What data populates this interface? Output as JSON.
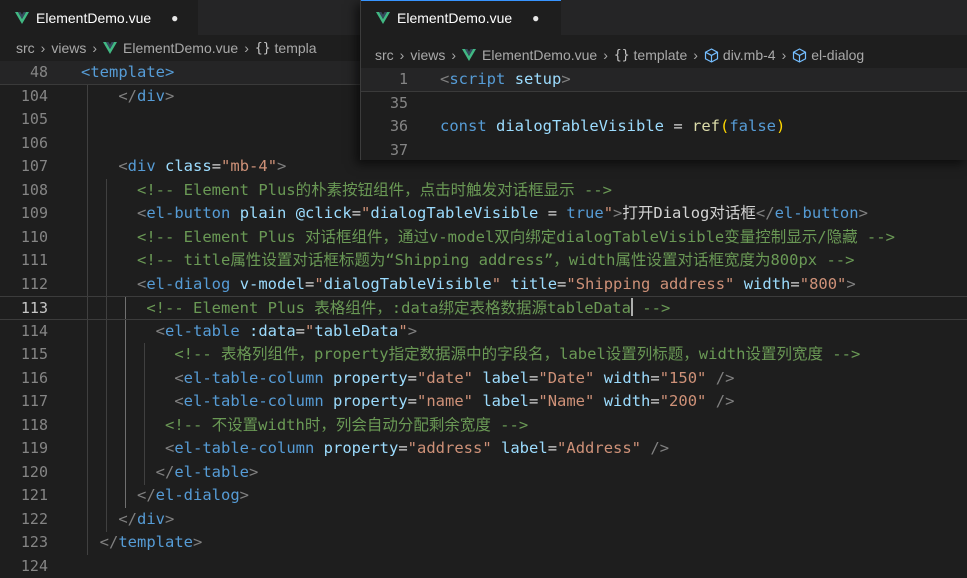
{
  "left_editor": {
    "tab": {
      "title": "ElementDemo.vue",
      "icon": "vue-icon",
      "dirty": "●"
    },
    "breadcrumb": [
      "src",
      "views",
      "ElementDemo.vue",
      "templa"
    ],
    "lines": [
      {
        "num": "48",
        "tokens": [
          [
            "tag",
            "<template>"
          ]
        ]
      },
      {
        "num": "104",
        "tokens": [
          [
            "t",
            "    "
          ],
          [
            "punc",
            "</"
          ],
          [
            "tag",
            "div"
          ],
          [
            "punc",
            ">"
          ]
        ]
      },
      {
        "num": "105",
        "tokens": []
      },
      {
        "num": "106",
        "tokens": []
      },
      {
        "num": "107",
        "tokens": [
          [
            "t",
            "    "
          ],
          [
            "punc",
            "<"
          ],
          [
            "tag",
            "div"
          ],
          [
            "t",
            " "
          ],
          [
            "attr",
            "class"
          ],
          [
            "t",
            "="
          ],
          [
            "str",
            "\"mb-4\""
          ],
          [
            "punc",
            ">"
          ]
        ]
      },
      {
        "num": "108",
        "tokens": [
          [
            "t",
            "      "
          ],
          [
            "com",
            "<!-- Element Plus的朴素按钮组件，点击时触发对话框显示 -->"
          ]
        ]
      },
      {
        "num": "109",
        "tokens": [
          [
            "t",
            "      "
          ],
          [
            "punc",
            "<"
          ],
          [
            "tag",
            "el-button"
          ],
          [
            "t",
            " "
          ],
          [
            "attr",
            "plain"
          ],
          [
            "t",
            " "
          ],
          [
            "attr",
            "@click"
          ],
          [
            "t",
            "="
          ],
          [
            "str",
            "\""
          ],
          [
            "attr",
            "dialogTableVisible"
          ],
          [
            "t",
            " = "
          ],
          [
            "kw",
            "true"
          ],
          [
            "str",
            "\""
          ],
          [
            "punc",
            ">"
          ],
          [
            "t",
            "打开Dialog对话框"
          ],
          [
            "punc",
            "</"
          ],
          [
            "tag",
            "el-button"
          ],
          [
            "punc",
            ">"
          ]
        ]
      },
      {
        "num": "110",
        "tokens": [
          [
            "t",
            "      "
          ],
          [
            "com",
            "<!-- Element Plus 对话框组件，通过v-model双向绑定dialogTableVisible变量控制显示/隐藏 -->"
          ]
        ]
      },
      {
        "num": "111",
        "tokens": [
          [
            "t",
            "      "
          ],
          [
            "com",
            "<!-- title属性设置对话框标题为“Shipping address”，width属性设置对话框宽度为800px -->"
          ]
        ]
      },
      {
        "num": "112",
        "tokens": [
          [
            "t",
            "      "
          ],
          [
            "punc",
            "<"
          ],
          [
            "tag",
            "el-dialog"
          ],
          [
            "t",
            " "
          ],
          [
            "attr",
            "v-model"
          ],
          [
            "t",
            "="
          ],
          [
            "str",
            "\""
          ],
          [
            "attr",
            "dialogTableVisible"
          ],
          [
            "str",
            "\""
          ],
          [
            "t",
            " "
          ],
          [
            "attr",
            "title"
          ],
          [
            "t",
            "="
          ],
          [
            "str",
            "\"Shipping address\""
          ],
          [
            "t",
            " "
          ],
          [
            "attr",
            "width"
          ],
          [
            "t",
            "="
          ],
          [
            "str",
            "\"800\""
          ],
          [
            "punc",
            ">"
          ]
        ]
      },
      {
        "num": "113",
        "tokens": [
          [
            "t",
            "       "
          ],
          [
            "com",
            "<!-- Element Plus 表格组件，:data绑定表格数据源tableData"
          ],
          [
            "caret",
            ""
          ],
          [
            "com",
            " -->"
          ]
        ]
      },
      {
        "num": "114",
        "tokens": [
          [
            "t",
            "        "
          ],
          [
            "punc",
            "<"
          ],
          [
            "tag",
            "el-table"
          ],
          [
            "t",
            " "
          ],
          [
            "attr",
            ":data"
          ],
          [
            "t",
            "="
          ],
          [
            "str",
            "\""
          ],
          [
            "attr",
            "tableData"
          ],
          [
            "str",
            "\""
          ],
          [
            "punc",
            ">"
          ]
        ]
      },
      {
        "num": "115",
        "tokens": [
          [
            "t",
            "          "
          ],
          [
            "com",
            "<!-- 表格列组件，property指定数据源中的字段名，label设置列标题，width设置列宽度 -->"
          ]
        ]
      },
      {
        "num": "116",
        "tokens": [
          [
            "t",
            "          "
          ],
          [
            "punc",
            "<"
          ],
          [
            "tag",
            "el-table-column"
          ],
          [
            "t",
            " "
          ],
          [
            "attr",
            "property"
          ],
          [
            "t",
            "="
          ],
          [
            "str",
            "\"date\""
          ],
          [
            "t",
            " "
          ],
          [
            "attr",
            "label"
          ],
          [
            "t",
            "="
          ],
          [
            "str",
            "\"Date\""
          ],
          [
            "t",
            " "
          ],
          [
            "attr",
            "width"
          ],
          [
            "t",
            "="
          ],
          [
            "str",
            "\"150\""
          ],
          [
            "t",
            " "
          ],
          [
            "punc",
            "/>"
          ]
        ]
      },
      {
        "num": "117",
        "tokens": [
          [
            "t",
            "          "
          ],
          [
            "punc",
            "<"
          ],
          [
            "tag",
            "el-table-column"
          ],
          [
            "t",
            " "
          ],
          [
            "attr",
            "property"
          ],
          [
            "t",
            "="
          ],
          [
            "str",
            "\"name\""
          ],
          [
            "t",
            " "
          ],
          [
            "attr",
            "label"
          ],
          [
            "t",
            "="
          ],
          [
            "str",
            "\"Name\""
          ],
          [
            "t",
            " "
          ],
          [
            "attr",
            "width"
          ],
          [
            "t",
            "="
          ],
          [
            "str",
            "\"200\""
          ],
          [
            "t",
            " "
          ],
          [
            "punc",
            "/>"
          ]
        ]
      },
      {
        "num": "118",
        "tokens": [
          [
            "t",
            "         "
          ],
          [
            "com",
            "<!-- 不设置width时，列会自动分配剩余宽度 -->"
          ]
        ]
      },
      {
        "num": "119",
        "tokens": [
          [
            "t",
            "         "
          ],
          [
            "punc",
            "<"
          ],
          [
            "tag",
            "el-table-column"
          ],
          [
            "t",
            " "
          ],
          [
            "attr",
            "property"
          ],
          [
            "t",
            "="
          ],
          [
            "str",
            "\"address\""
          ],
          [
            "t",
            " "
          ],
          [
            "attr",
            "label"
          ],
          [
            "t",
            "="
          ],
          [
            "str",
            "\"Address\""
          ],
          [
            "t",
            " "
          ],
          [
            "punc",
            "/>"
          ]
        ]
      },
      {
        "num": "120",
        "tokens": [
          [
            "t",
            "        "
          ],
          [
            "punc",
            "</"
          ],
          [
            "tag",
            "el-table"
          ],
          [
            "punc",
            ">"
          ]
        ]
      },
      {
        "num": "121",
        "tokens": [
          [
            "t",
            "      "
          ],
          [
            "punc",
            "</"
          ],
          [
            "tag",
            "el-dialog"
          ],
          [
            "punc",
            ">"
          ]
        ]
      },
      {
        "num": "122",
        "tokens": [
          [
            "t",
            "    "
          ],
          [
            "punc",
            "</"
          ],
          [
            "tag",
            "div"
          ],
          [
            "punc",
            ">"
          ]
        ]
      },
      {
        "num": "123",
        "tokens": [
          [
            "t",
            "  "
          ],
          [
            "punc",
            "</"
          ],
          [
            "tag",
            "template"
          ],
          [
            "punc",
            ">"
          ]
        ]
      },
      {
        "num": "124",
        "tokens": []
      }
    ],
    "active_line": "113"
  },
  "right_editor": {
    "tab": {
      "title": "ElementDemo.vue",
      "icon": "vue-icon",
      "dirty": "●"
    },
    "breadcrumb": [
      "src",
      "views",
      "ElementDemo.vue",
      "template",
      "div.mb-4",
      "el-dialog"
    ],
    "lines": [
      {
        "num": "1",
        "tokens": [
          [
            "punc",
            "<"
          ],
          [
            "tag",
            "script"
          ],
          [
            "t",
            " "
          ],
          [
            "attr",
            "setup"
          ],
          [
            "punc",
            ">"
          ]
        ]
      },
      {
        "num": "35",
        "tokens": []
      },
      {
        "num": "36",
        "tokens": [
          [
            "kw",
            "const"
          ],
          [
            "t",
            " "
          ],
          [
            "attr",
            "dialogTableVisible"
          ],
          [
            "t",
            " = "
          ],
          [
            "fn",
            "ref"
          ],
          [
            "paren",
            "("
          ],
          [
            "kw",
            "false"
          ],
          [
            "paren",
            ")"
          ]
        ]
      },
      {
        "num": "37",
        "tokens": []
      }
    ]
  },
  "colors": {
    "background": "#1e1e1e",
    "tag": "#569cd6",
    "attribute": "#9cdcfe",
    "string": "#ce9178",
    "comment": "#6a9955",
    "vue_green": "#41b883"
  }
}
